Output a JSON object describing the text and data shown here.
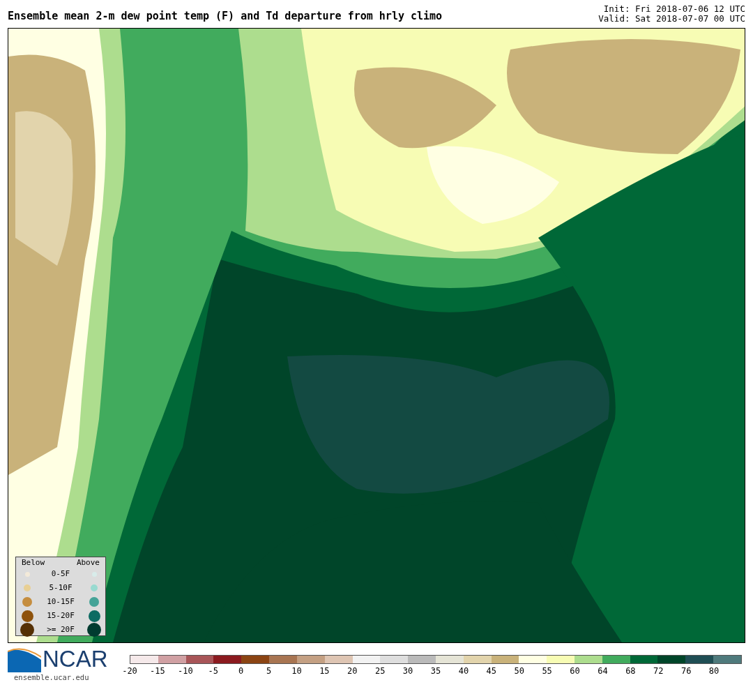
{
  "title": "Ensemble mean 2-m dew point temp (F) and Td departure from hrly climo",
  "init": "Init: Fri 2018-07-06 12 UTC",
  "valid": "Valid: Sat 2018-07-07 00 UTC",
  "legend": {
    "below_label": "Below",
    "above_label": "Above",
    "rows": [
      {
        "label": "0-5F",
        "below": {
          "color": "#f3ead9"
        },
        "above": {
          "color": "#d8ecea"
        }
      },
      {
        "label": "5-10F",
        "below": {
          "color": "#e8cf94"
        },
        "above": {
          "color": "#98dad0"
        }
      },
      {
        "label": "10-15F",
        "below": {
          "color": "#c58d3e"
        },
        "above": {
          "color": "#45a397"
        }
      },
      {
        "label": "15-20F",
        "below": {
          "color": "#8e520c"
        },
        "above": {
          "color": "#0c6b62"
        }
      },
      {
        "label": ">= 20F",
        "below": {
          "color": "#553005"
        },
        "above": {
          "color": "#003c30"
        }
      }
    ]
  },
  "logo": {
    "text": "NCAR",
    "url": "ensemble.ucar.edu"
  },
  "colorbar": {
    "segments": [
      {
        "color": "#f5e9ea"
      },
      {
        "color": "#d0a0a3"
      },
      {
        "color": "#a85558"
      },
      {
        "color": "#8b1a1f"
      },
      {
        "color": "#8b4413"
      },
      {
        "color": "#a87552"
      },
      {
        "color": "#c4a083"
      },
      {
        "color": "#dec5b3"
      },
      {
        "color": "#f2f2f2"
      },
      {
        "color": "#dedede"
      },
      {
        "color": "#bababa"
      },
      {
        "color": "#e5e4d6"
      },
      {
        "color": "#e2d4ac"
      },
      {
        "color": "#c9b27a"
      },
      {
        "color": "#ffffe3"
      },
      {
        "color": "#f7fcb4"
      },
      {
        "color": "#addd8e"
      },
      {
        "color": "#41ab5d"
      },
      {
        "color": "#006837"
      },
      {
        "color": "#004529"
      },
      {
        "color": "#1f4e54"
      },
      {
        "color": "#4f7a7c"
      }
    ],
    "ticks": [
      "-20",
      "-15",
      "-10",
      "-5",
      "0",
      "5",
      "10",
      "15",
      "20",
      "25",
      "30",
      "35",
      "40",
      "45",
      "50",
      "55",
      "60",
      "64",
      "68",
      "72",
      "76",
      "80"
    ]
  }
}
